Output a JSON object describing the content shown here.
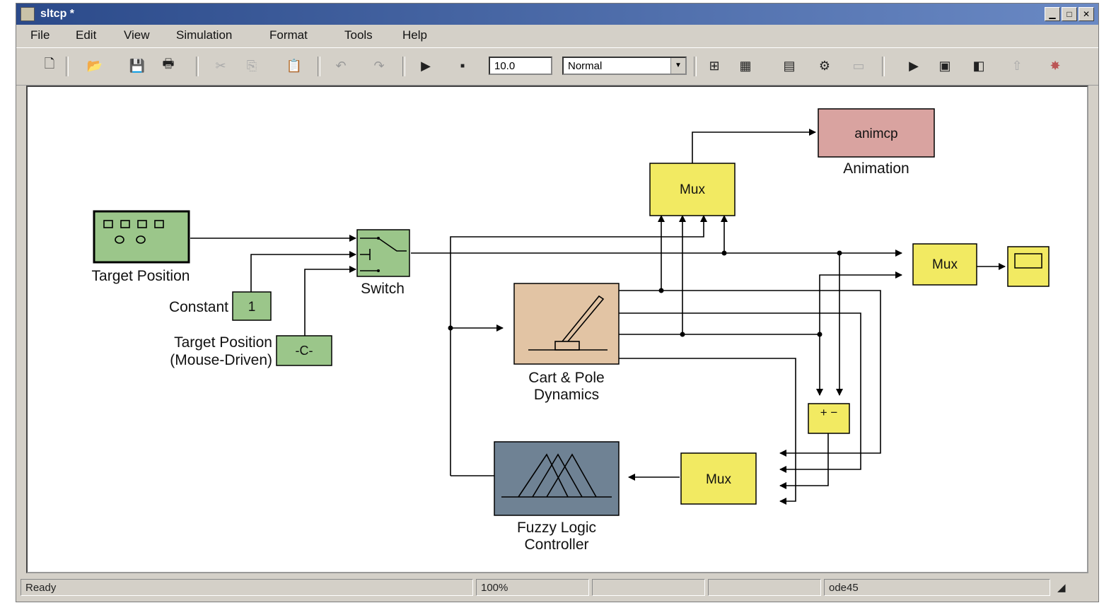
{
  "window": {
    "title": "sltcp *"
  },
  "menu": [
    "File",
    "Edit",
    "View",
    "Simulation",
    "Format",
    "Tools",
    "Help"
  ],
  "toolbar": {
    "stop_time": "10.0",
    "sim_mode": "Normal"
  },
  "blocks": {
    "target_position": {
      "label": "Target Position"
    },
    "constant": {
      "label": "Constant",
      "value": "1"
    },
    "target_position_mouse": {
      "label_line1": "Target Position",
      "label_line2": "(Mouse-Driven)",
      "value": "-C-"
    },
    "switch": {
      "label": "Switch"
    },
    "mux_top": {
      "label": "Mux"
    },
    "animation": {
      "label": "Animation",
      "value": "animcp"
    },
    "mux_right": {
      "label": "Mux"
    },
    "cart_pole": {
      "label_line1": "Cart & Pole",
      "label_line2": "Dynamics"
    },
    "sum": {
      "value": "+ −"
    },
    "mux_bottom": {
      "label": "Mux"
    },
    "fuzzy": {
      "label_line1": "Fuzzy Logic",
      "label_line2": "Controller"
    }
  },
  "status": {
    "state": "Ready",
    "zoom": "100%",
    "solver": "ode45"
  },
  "colors": {
    "green_block": "#9bc68a",
    "yellow_block": "#f2ea62",
    "pink_block": "#d9a3a0",
    "tan_block": "#e2c4a4",
    "slate_block": "#6f8294",
    "titlebar": "#2b4a8a"
  }
}
